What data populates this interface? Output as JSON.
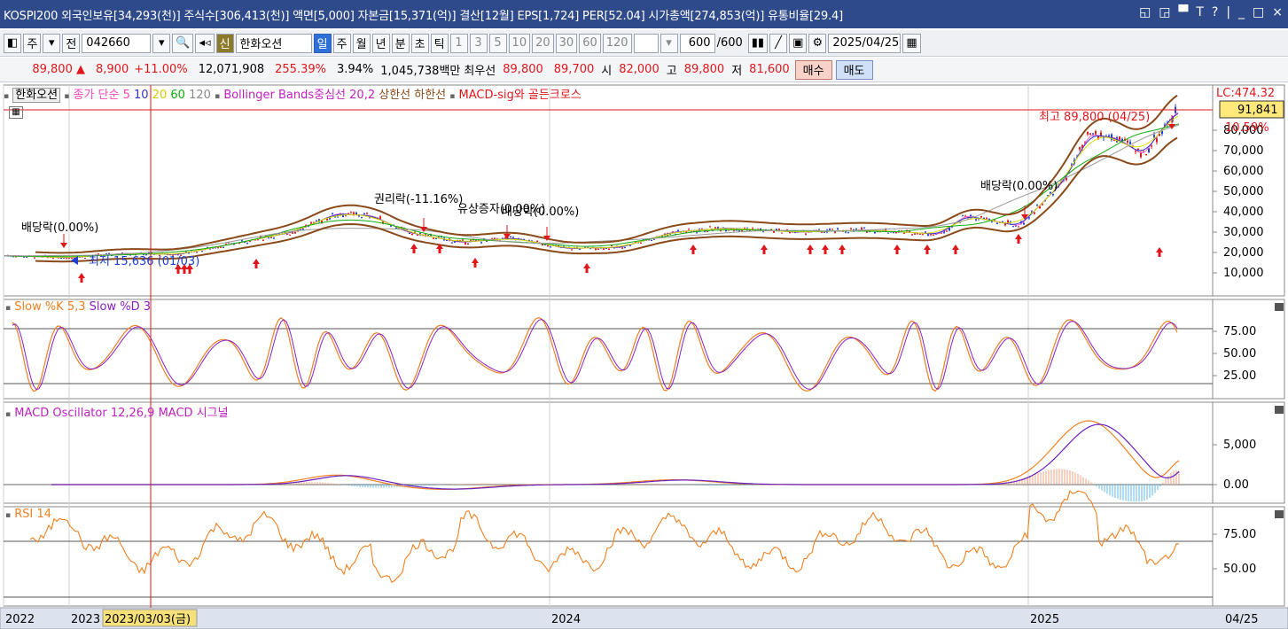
{
  "titlebar": {
    "text": "KOSPI200 외국인보유[34,293(천)] 주식수[306,413(천)] 액면[5,000] 자본금[15,371(억)] 결산[12월] EPS[1,724] PER[52.04] 시가총액[274,853(억)] 유통비율[29.4]",
    "window_buttons": [
      "◱",
      "◲",
      "▀",
      "T",
      "?",
      "|",
      "_",
      "□",
      "×"
    ]
  },
  "toolbar": {
    "mode_label": "주",
    "prev_label": "전",
    "code": "042660",
    "new_badge": "신",
    "stock_name": "한화오션",
    "periods": [
      "일",
      "주",
      "월",
      "년",
      "분",
      "초",
      "틱"
    ],
    "active_period": "일",
    "intervals": [
      "1",
      "3",
      "5",
      "10",
      "20",
      "30",
      "60",
      "120"
    ],
    "count": "600",
    "count_total": "/600",
    "date": "2025/04/25"
  },
  "quote": {
    "price": "89,800",
    "change": "8,900",
    "change_pct": "+11.00%",
    "volume": "12,071,908",
    "vol_ratio": "255.39%",
    "turnover": "3.94%",
    "amount": "1,045,738백만",
    "best_label": "최우선",
    "ask": "89,800",
    "bid": "89,700",
    "open_label": "시",
    "open": "82,000",
    "high_label": "고",
    "high": "89,800",
    "low_label": "저",
    "low": "81,600",
    "buy_label": "매수",
    "sell_label": "매도"
  },
  "panels": {
    "price": {
      "stock": "한화오션",
      "ma_label": "종가 단순",
      "ma_periods": [
        "5",
        "10",
        "20",
        "60",
        "120"
      ],
      "bb_label": "Bollinger Bands중심선 20,2",
      "upper_label": "상한선",
      "lower_label": "하한선",
      "macd_sig_label": "MACD-sig와 골든크로스",
      "lc_label": "LC:474.32",
      "current_price_tag": "91,841",
      "pct_tag": "10.59%",
      "y_ticks": [
        "80,000",
        "70,000",
        "60,000",
        "50,000",
        "40,000",
        "30,000",
        "20,000",
        "10,000"
      ],
      "annotations": {
        "high": "최고 89,800 (04/25)",
        "low": "최저 15,636 (01/03)",
        "div1": "배당락(0.00%)",
        "rights": "권리락(-11.16%)",
        "bonus": "유상증자(0.00%)",
        "div2": "배당락(0.00%)",
        "div3": "배당락(0.00%)"
      }
    },
    "stoch": {
      "label1": "Slow %K 5,3",
      "label2": "Slow %D 3",
      "y_ticks": [
        "75.00",
        "50.00",
        "25.00"
      ]
    },
    "macd": {
      "label1": "MACD Oscillator 12,26,9",
      "label2": "MACD",
      "label3": "시그널",
      "y_ticks": [
        "5,000",
        "0.00"
      ]
    },
    "rsi": {
      "label1": "RSI 14",
      "y_ticks": [
        "75.00",
        "50.00"
      ]
    }
  },
  "xaxis": {
    "labels": [
      "2022",
      "2023",
      "2023/03/03(금)",
      "2024",
      "2025"
    ],
    "right_label": "04/25"
  },
  "colors": {
    "titlebar": "#2f4a8a",
    "up": "#e0161b",
    "down": "#1a3fd6",
    "ma5": "#ff66cc",
    "ma10": "#3333cc",
    "ma20": "#dddd00",
    "ma60": "#11aa11",
    "ma120": "#999999",
    "bollinger": "#8b4a1a"
  }
}
